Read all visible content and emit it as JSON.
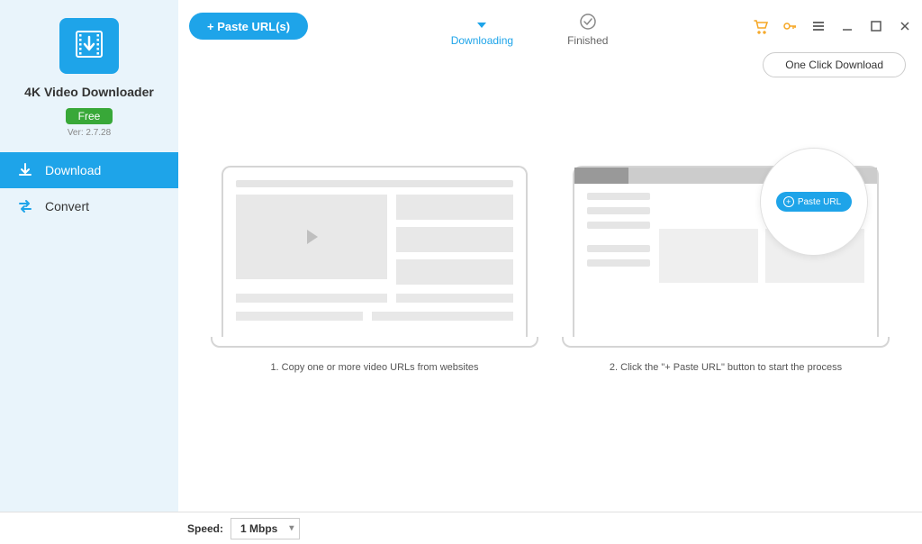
{
  "sidebar": {
    "app_title": "4K Video Downloader",
    "badge": "Free",
    "version": "Ver: 2.7.28",
    "items": [
      {
        "label": "Download",
        "active": true
      },
      {
        "label": "Convert",
        "active": false
      }
    ]
  },
  "header": {
    "paste_button": "+ Paste URL(s)",
    "tabs": {
      "downloading": "Downloading",
      "finished": "Finished"
    },
    "one_click": "One Click Download"
  },
  "illustrations": {
    "step1_caption": "1. Copy one or more video URLs from websites",
    "step2_caption": "2. Click the \"+ Paste URL\" button to start the process",
    "mini_paste_label": "Paste URL"
  },
  "footer": {
    "speed_label": "Speed:",
    "speed_value": "1 Mbps"
  },
  "colors": {
    "accent": "#1ea4e9",
    "badge_green": "#38a838",
    "sidebar_bg": "#e9f4fb",
    "cart_orange": "#f5a623"
  }
}
